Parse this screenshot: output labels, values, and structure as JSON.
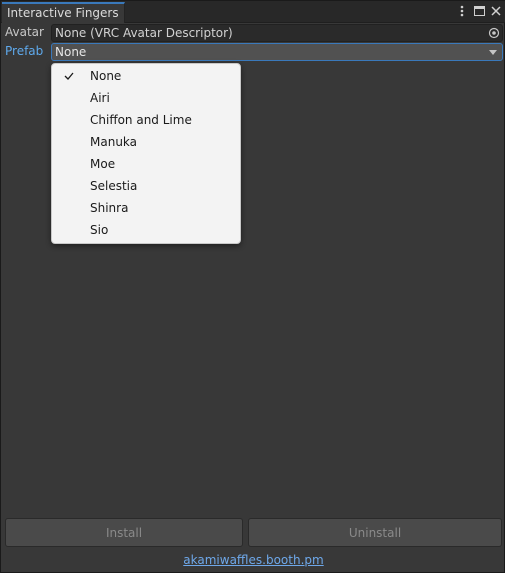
{
  "window": {
    "tab_title": "Interactive Fingers"
  },
  "fields": {
    "avatar": {
      "label": "Avatar",
      "value": "None (VRC Avatar Descriptor)"
    },
    "prefab": {
      "label": "Prefab",
      "value": "None"
    }
  },
  "dropdown": {
    "selected": "None",
    "options": [
      "None",
      "Airi",
      "Chiffon and Lime",
      "Manuka",
      "Moe",
      "Selestia",
      "Shinra",
      "Sio"
    ]
  },
  "buttons": {
    "install": "Install",
    "uninstall": "Uninstall"
  },
  "footer": {
    "link": "akamiwaffles.booth.pm"
  },
  "colors": {
    "accent": "#3a79bb",
    "prefab_label": "#5ea9ec",
    "link": "#6ea8ea"
  }
}
